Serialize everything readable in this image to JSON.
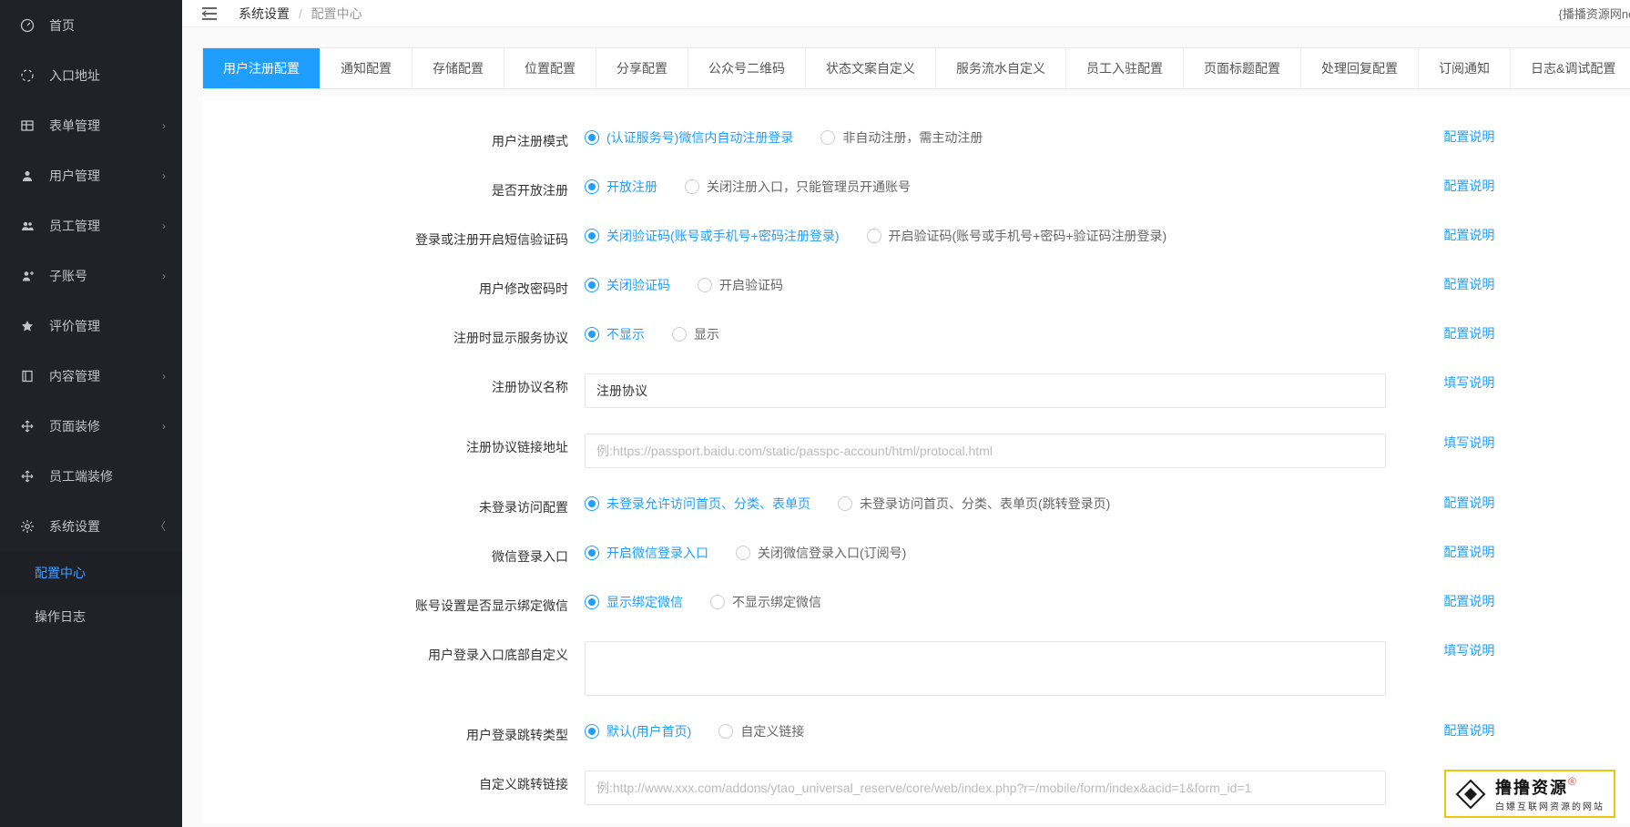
{
  "breadcrumb": {
    "parent": "系统设置",
    "current": "配置中心"
  },
  "topRight": "{播播资源网ne",
  "sidebar": {
    "items": [
      {
        "icon": "dashboard",
        "label": "首页",
        "hasChildren": false
      },
      {
        "icon": "link",
        "label": "入口地址",
        "hasChildren": false
      },
      {
        "icon": "table",
        "label": "表单管理",
        "hasChildren": true
      },
      {
        "icon": "user",
        "label": "用户管理",
        "hasChildren": true
      },
      {
        "icon": "users",
        "label": "员工管理",
        "hasChildren": true
      },
      {
        "icon": "subuser",
        "label": "子账号",
        "hasChildren": true
      },
      {
        "icon": "star",
        "label": "评价管理",
        "hasChildren": false
      },
      {
        "icon": "book",
        "label": "内容管理",
        "hasChildren": true
      },
      {
        "icon": "move",
        "label": "页面装修",
        "hasChildren": true
      },
      {
        "icon": "move",
        "label": "员工端装修",
        "hasChildren": false
      },
      {
        "icon": "gear",
        "label": "系统设置",
        "hasChildren": true,
        "expanded": true
      }
    ],
    "subItems": [
      {
        "label": "配置中心",
        "active": true
      },
      {
        "label": "操作日志",
        "active": false
      }
    ]
  },
  "tabs": [
    "用户注册配置",
    "通知配置",
    "存储配置",
    "位置配置",
    "分享配置",
    "公众号二维码",
    "状态文案自定义",
    "服务流水自定义",
    "员工入驻配置",
    "页面标题配置",
    "处理回复配置",
    "订阅通知",
    "日志&调试配置"
  ],
  "activeTab": 0,
  "hints": {
    "config": "配置说明",
    "fill": "填写说明"
  },
  "form": {
    "rows": [
      {
        "label": "用户注册模式",
        "type": "radio",
        "hint": "config",
        "options": [
          {
            "text": "(认证服务号)微信内自动注册登录",
            "checked": true
          },
          {
            "text": "非自动注册，需主动注册",
            "checked": false
          }
        ]
      },
      {
        "label": "是否开放注册",
        "type": "radio",
        "hint": "config",
        "options": [
          {
            "text": "开放注册",
            "checked": true
          },
          {
            "text": "关闭注册入口，只能管理员开通账号",
            "checked": false
          }
        ]
      },
      {
        "label": "登录或注册开启短信验证码",
        "type": "radio",
        "hint": "config",
        "options": [
          {
            "text": "关闭验证码(账号或手机号+密码注册登录)",
            "checked": true
          },
          {
            "text": "开启验证码(账号或手机号+密码+验证码注册登录)",
            "checked": false
          }
        ]
      },
      {
        "label": "用户修改密码时",
        "type": "radio",
        "hint": "config",
        "options": [
          {
            "text": "关闭验证码",
            "checked": true
          },
          {
            "text": "开启验证码",
            "checked": false
          }
        ]
      },
      {
        "label": "注册时显示服务协议",
        "type": "radio",
        "hint": "config",
        "options": [
          {
            "text": "不显示",
            "checked": true
          },
          {
            "text": "显示",
            "checked": false
          }
        ]
      },
      {
        "label": "注册协议名称",
        "type": "input",
        "hint": "fill",
        "value": "注册协议",
        "placeholder": ""
      },
      {
        "label": "注册协议链接地址",
        "type": "input",
        "hint": "fill",
        "value": "",
        "placeholder": "例:https://passport.baidu.com/static/passpc-account/html/protocal.html"
      },
      {
        "label": "未登录访问配置",
        "type": "radio",
        "hint": "config",
        "options": [
          {
            "text": "未登录允许访问首页、分类、表单页",
            "checked": true
          },
          {
            "text": "未登录访问首页、分类、表单页(跳转登录页)",
            "checked": false
          }
        ]
      },
      {
        "label": "微信登录入口",
        "type": "radio",
        "hint": "config",
        "options": [
          {
            "text": "开启微信登录入口",
            "checked": true
          },
          {
            "text": "关闭微信登录入口(订阅号)",
            "checked": false
          }
        ]
      },
      {
        "label": "账号设置是否显示绑定微信",
        "type": "radio",
        "hint": "config",
        "options": [
          {
            "text": "显示绑定微信",
            "checked": true
          },
          {
            "text": "不显示绑定微信",
            "checked": false
          }
        ]
      },
      {
        "label": "用户登录入口底部自定义",
        "type": "textarea",
        "hint": "fill",
        "value": ""
      },
      {
        "label": "用户登录跳转类型",
        "type": "radio",
        "hint": "config",
        "options": [
          {
            "text": "默认(用户首页)",
            "checked": true
          },
          {
            "text": "自定义链接",
            "checked": false
          }
        ]
      },
      {
        "label": "自定义跳转链接",
        "type": "input",
        "hint": "fill",
        "value": "",
        "placeholder": "例:http://www.xxx.com/addons/ytao_universal_reserve/core/web/index.php?r=/mobile/form/index&acid=1&form_id=1"
      }
    ]
  },
  "watermark": {
    "brand": "撸撸资源",
    "reg": "®",
    "tagline": "白嫖互联网资源的网站"
  }
}
